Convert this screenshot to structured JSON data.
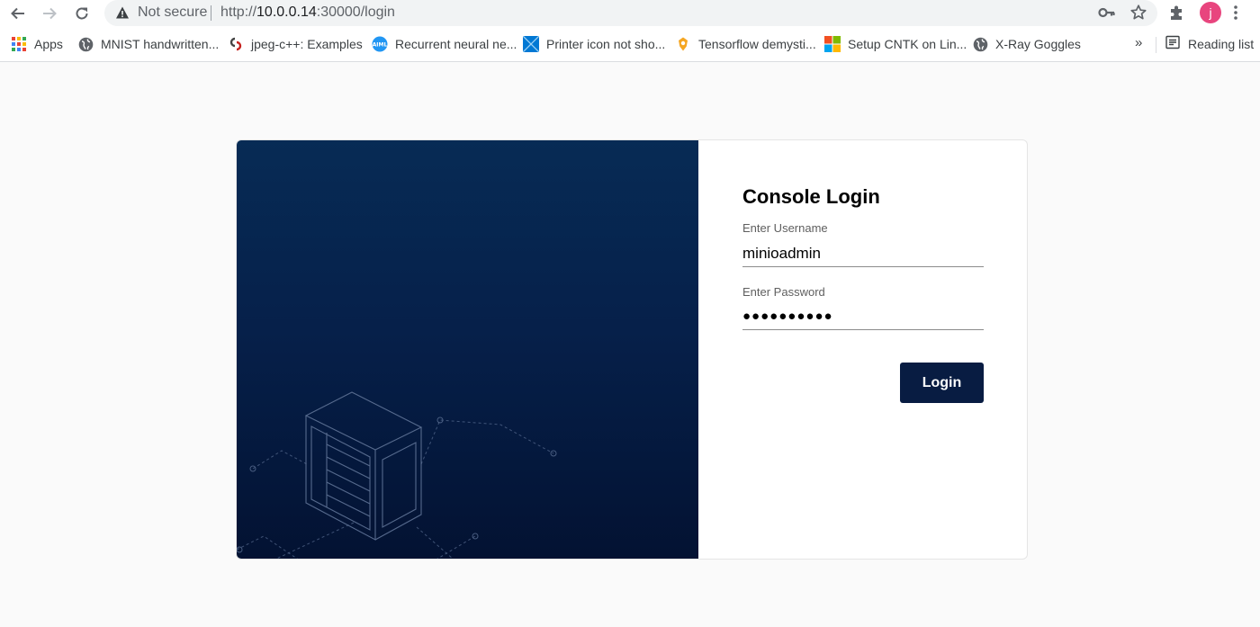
{
  "browser": {
    "omnibox": {
      "security_text": "Not secure",
      "url_scheme": "http://",
      "url_host": "10.0.0.14",
      "url_path": ":30000/login"
    },
    "profile_initial": "j",
    "profile_color": "#e8457e"
  },
  "bookmarks": {
    "items": [
      {
        "label": "Apps",
        "icon": "apps-grid-icon"
      },
      {
        "label": "MNIST handwritten...",
        "icon": "globe-icon"
      },
      {
        "label": "jpeg-c++: Examples",
        "icon": "jpeg-site-icon"
      },
      {
        "label": "Recurrent neural ne...",
        "icon": "aiml-icon"
      },
      {
        "label": "Printer icon not sho...",
        "icon": "windows-blue-icon"
      },
      {
        "label": "Tensorflow demysti...",
        "icon": "medium-icon"
      },
      {
        "label": "Setup CNTK on Lin...",
        "icon": "microsoft-logo-icon"
      },
      {
        "label": "X-Ray Goggles",
        "icon": "globe-icon"
      }
    ],
    "more": "»",
    "reading_list": "Reading list"
  },
  "login": {
    "title": "Console Login",
    "username_label": "Enter Username",
    "username_value": "minioadmin",
    "password_label": "Enter Password",
    "password_mask": "●●●●●●●●●●",
    "button_label": "Login",
    "accent_color": "#081c42"
  }
}
